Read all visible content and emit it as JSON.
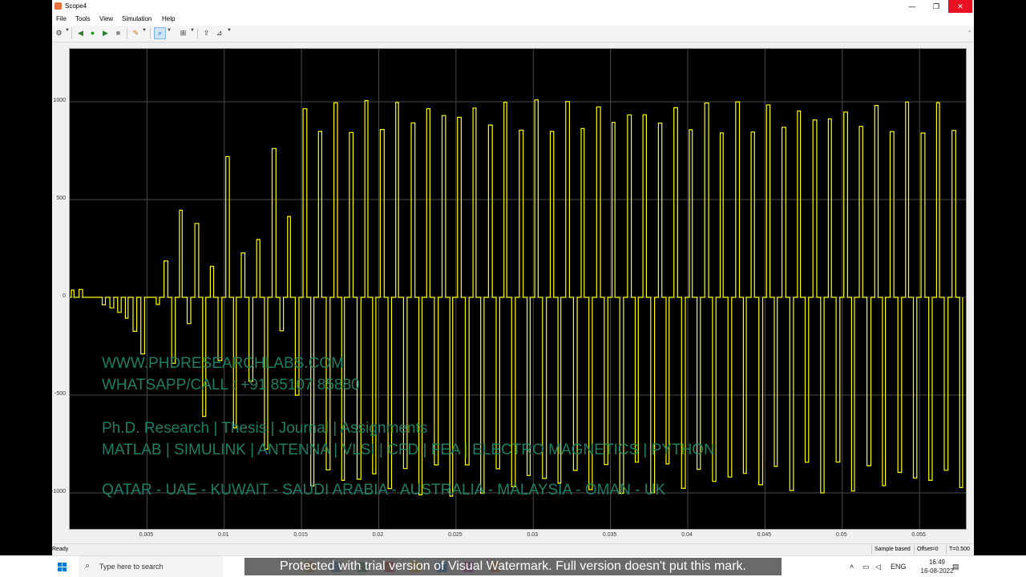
{
  "window": {
    "title": "Scope4",
    "controls": {
      "minimize": "—",
      "restore": "❐",
      "close": "✕"
    }
  },
  "menu": [
    "File",
    "Tools",
    "View",
    "Simulation",
    "Help"
  ],
  "toolbar": {
    "icons": [
      "gear-icon",
      "step-back-icon",
      "run-icon",
      "step-forward-icon",
      "stop-icon",
      "highlight-icon",
      "zoom-icon",
      "fit-icon",
      "triggers-icon",
      "cursor-measurements-icon"
    ]
  },
  "chart_data": {
    "type": "line",
    "title": "",
    "xlabel": "",
    "ylabel": "",
    "xlim": [
      0.0,
      0.058
    ],
    "ylim": [
      -1150,
      1000
    ],
    "xticks": [
      "0.005",
      "0.01",
      "0.015",
      "0.02",
      "0.025",
      "0.03",
      "0.035",
      "0.04",
      "0.045",
      "0.05",
      "0.055"
    ],
    "xtick_values": [
      0.005,
      0.01,
      0.015,
      0.02,
      0.025,
      0.03,
      0.035,
      0.04,
      0.045,
      0.05,
      0.055
    ],
    "yticks": [
      "1000",
      "500",
      "0",
      "-500",
      "-1000"
    ],
    "ytick_values": [
      1000,
      500,
      0,
      -500,
      -1000
    ],
    "grid": true,
    "series_color": "#ffff00",
    "background": "#000000",
    "signal": "switched square-wave voltage",
    "envelope": [
      {
        "t": 0.0,
        "v": 0
      },
      {
        "t": 0.0009,
        "v": 60
      },
      {
        "t": 0.004,
        "v": -150
      },
      {
        "t": 0.0047,
        "v": -330
      },
      {
        "t": 0.0066,
        "v": 370
      },
      {
        "t": 0.0072,
        "v": 560
      },
      {
        "t": 0.0085,
        "v": -800
      },
      {
        "t": 0.01,
        "v": 740
      },
      {
        "t": 0.011,
        "v": 820
      },
      {
        "t": 0.0113,
        "v": -880
      },
      {
        "t": 0.0125,
        "v": 920
      },
      {
        "t": 0.013,
        "v": 940
      },
      {
        "t": 0.0145,
        "v": -980
      },
      {
        "t": 0.015,
        "v": 990
      },
      {
        "t": 0.022,
        "v": 1020
      },
      {
        "t": 0.03,
        "v": 1010
      },
      {
        "t": 0.04,
        "v": 1000
      },
      {
        "t": 0.058,
        "v": 1000
      }
    ]
  },
  "statusbar": {
    "status": "Ready",
    "mode": "Sample based",
    "offset": "Offset=0",
    "time": "T=0.500"
  },
  "watermark": {
    "line1": "WWW.PHDRESEARCHLABS.COM",
    "line2": "WHATSAPP/CALL : +91 85107 85880",
    "line3": "Ph.D. Research | Thesis | Journal | Assignments",
    "line4": "MATLAB | SIMULINK | ANTENNA | VLSI | CFD | FEA | ELECTRO MAGNETICS | PYTHON",
    "line5": "QATAR - UAE - KUWAIT - SAUDI ARABIA - AUSTRALIA - MALAYSIA - OMAN - UK"
  },
  "banner": "Protected with trial version of Visual Watermark. Full version doesn't put this mark.",
  "taskbar": {
    "search_placeholder": "Type here to search",
    "language": "ENG",
    "time": "16:49",
    "date": "16-08-2022",
    "app_colors": [
      "#e0a030",
      "#3a7bd5",
      "#2e8b57",
      "#d13438",
      "#f4b400",
      "#0a84ff",
      "#c239b3",
      "#e86f1f"
    ]
  }
}
